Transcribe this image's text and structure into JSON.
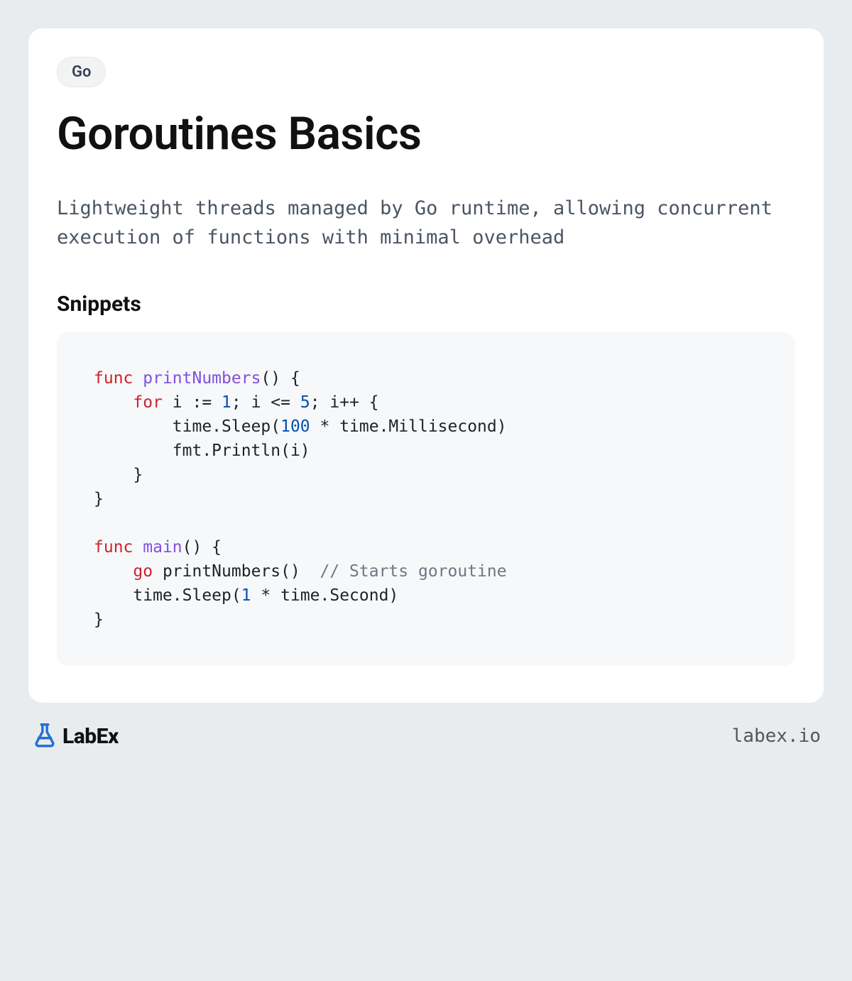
{
  "tag": "Go",
  "title": "Goroutines Basics",
  "description": "Lightweight threads managed by Go runtime, allowing concurrent execution of functions with minimal overhead",
  "section_heading": "Snippets",
  "code": {
    "tokens": [
      {
        "t": "func ",
        "c": "kw"
      },
      {
        "t": "printNumbers",
        "c": "fn"
      },
      {
        "t": "() {\n    ",
        "c": ""
      },
      {
        "t": "for",
        "c": "kw"
      },
      {
        "t": " i := ",
        "c": ""
      },
      {
        "t": "1",
        "c": "num"
      },
      {
        "t": "; i <= ",
        "c": ""
      },
      {
        "t": "5",
        "c": "num"
      },
      {
        "t": "; i++ {\n        time.Sleep(",
        "c": ""
      },
      {
        "t": "100",
        "c": "num"
      },
      {
        "t": " * time.Millisecond)\n        fmt.Println(i)\n    }\n}\n\n",
        "c": ""
      },
      {
        "t": "func ",
        "c": "kw"
      },
      {
        "t": "main",
        "c": "fn"
      },
      {
        "t": "() {\n    ",
        "c": ""
      },
      {
        "t": "go",
        "c": "kw"
      },
      {
        "t": " printNumbers()  ",
        "c": ""
      },
      {
        "t": "// Starts goroutine",
        "c": "cm"
      },
      {
        "t": "\n    time.Sleep(",
        "c": ""
      },
      {
        "t": "1",
        "c": "num"
      },
      {
        "t": " * time.Second)\n}",
        "c": ""
      }
    ]
  },
  "footer": {
    "brand": "LabEx",
    "site": "labex.io"
  }
}
